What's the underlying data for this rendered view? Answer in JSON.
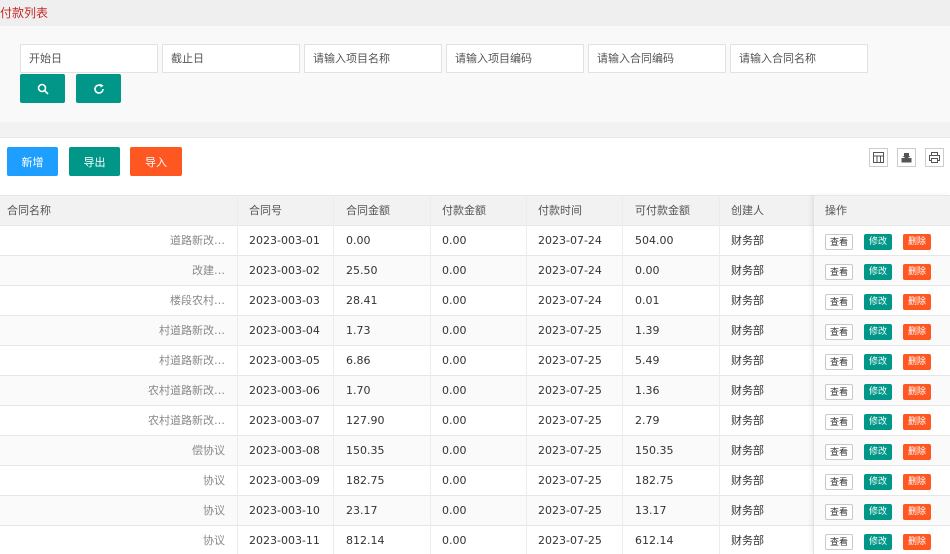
{
  "page": {
    "title": "付款列表"
  },
  "filters": {
    "start_date": "开始日",
    "end_date": "截止日",
    "project_name": "请输入项目名称",
    "project_code": "请输入项目编码",
    "contract_code": "请输入合同编码",
    "contract_name": "请输入合同名称"
  },
  "icons": {
    "search": "search-icon",
    "refresh": "refresh-icon"
  },
  "toolbar": {
    "add": "新增",
    "export": "导出",
    "import": "导入"
  },
  "colors": {
    "teal": "#009688",
    "blue": "#1e9fff",
    "orange": "#ff5722",
    "title_red": "#c62828"
  },
  "table": {
    "headers": [
      "合同名称",
      "合同号",
      "合同金额",
      "付款金额",
      "付款时间",
      "可付款金额",
      "创建人",
      "操作"
    ],
    "action_labels": {
      "view": "查看",
      "edit": "修改",
      "delete": "删除"
    },
    "rows": [
      {
        "name": "道路新改…",
        "no": "2023-003-01",
        "amount": "0.00",
        "paid": "0.00",
        "date": "2023-07-24",
        "available": "504.00",
        "creator": "财务部"
      },
      {
        "name": "改建…",
        "no": "2023-003-02",
        "amount": "25.50",
        "paid": "0.00",
        "date": "2023-07-24",
        "available": "0.00",
        "creator": "财务部"
      },
      {
        "name": "楼段农村…",
        "no": "2023-003-03",
        "amount": "28.41",
        "paid": "0.00",
        "date": "2023-07-24",
        "available": "0.01",
        "creator": "财务部"
      },
      {
        "name": "村道路新改…",
        "no": "2023-003-04",
        "amount": "1.73",
        "paid": "0.00",
        "date": "2023-07-25",
        "available": "1.39",
        "creator": "财务部"
      },
      {
        "name": "村道路新改…",
        "no": "2023-003-05",
        "amount": "6.86",
        "paid": "0.00",
        "date": "2023-07-25",
        "available": "5.49",
        "creator": "财务部"
      },
      {
        "name": "农村道路新改…",
        "no": "2023-003-06",
        "amount": "1.70",
        "paid": "0.00",
        "date": "2023-07-25",
        "available": "1.36",
        "creator": "财务部"
      },
      {
        "name": "农村道路新改…",
        "no": "2023-003-07",
        "amount": "127.90",
        "paid": "0.00",
        "date": "2023-07-25",
        "available": "2.79",
        "creator": "财务部"
      },
      {
        "name": "偿协议",
        "no": "2023-003-08",
        "amount": "150.35",
        "paid": "0.00",
        "date": "2023-07-25",
        "available": "150.35",
        "creator": "财务部"
      },
      {
        "name": "协议",
        "no": "2023-003-09",
        "amount": "182.75",
        "paid": "0.00",
        "date": "2023-07-25",
        "available": "182.75",
        "creator": "财务部"
      },
      {
        "name": "协议",
        "no": "2023-003-10",
        "amount": "23.17",
        "paid": "0.00",
        "date": "2023-07-25",
        "available": "13.17",
        "creator": "财务部"
      },
      {
        "name": "协议",
        "no": "2023-003-11",
        "amount": "812.14",
        "paid": "0.00",
        "date": "2023-07-25",
        "available": "612.14",
        "creator": "财务部"
      }
    ]
  }
}
